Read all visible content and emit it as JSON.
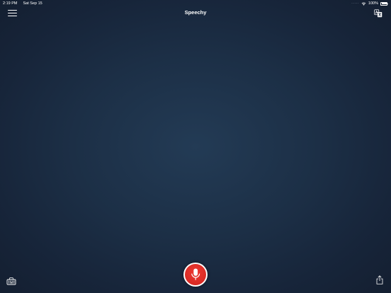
{
  "status_bar": {
    "time": "2:19 PM",
    "date": "Sat Sep 15",
    "battery_text": "100%",
    "battery_level": 1.0,
    "icons": [
      "signal-dots-icon",
      "wifi-icon",
      "battery-icon"
    ]
  },
  "header": {
    "title": "Speechy",
    "left_icon": "hamburger-menu-icon",
    "right_icon": "translate-icon"
  },
  "toolbar": {
    "left_icon": "keyboard-icon",
    "center_icon": "microphone-icon",
    "right_icon": "share-icon"
  },
  "colors": {
    "background_center": "#233b55",
    "background_edge": "#141f31",
    "mic_red": "#e0302a",
    "foreground": "#ffffff"
  }
}
